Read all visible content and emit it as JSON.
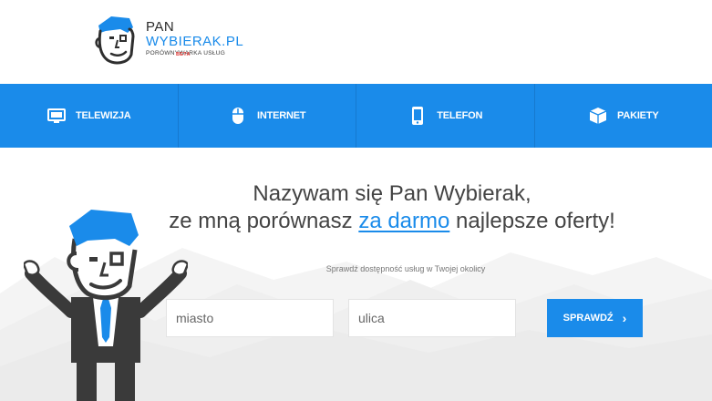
{
  "header": {
    "logo_line1": "PAN",
    "logo_line2": "WYBIERAK.PL",
    "logo_line3": "PORÓWNYWARKA USŁUG",
    "logo_beta": "BETA"
  },
  "nav": {
    "items": [
      {
        "label": "TELEWIZJA",
        "icon": "tv-icon"
      },
      {
        "label": "INTERNET",
        "icon": "mouse-icon"
      },
      {
        "label": "TELEFON",
        "icon": "phone-icon"
      },
      {
        "label": "PAKIETY",
        "icon": "box-icon"
      }
    ]
  },
  "hero": {
    "headline_line1": "Nazywam się Pan Wybierak,",
    "headline_line2_pre": "ze mną porównasz ",
    "headline_line2_link": "za darmo",
    "headline_line2_post": " najlepsze oferty!",
    "subtext": "Sprawdź dostępność usług w Twojej okolicy",
    "city_placeholder": "miasto",
    "street_placeholder": "ulica",
    "check_button": "SPRAWDŹ",
    "check_icon": "chevron-right-icon"
  },
  "colors": {
    "accent": "#1a8bea",
    "mascot_dark": "#3a3a3a",
    "beta": "#e53935"
  }
}
